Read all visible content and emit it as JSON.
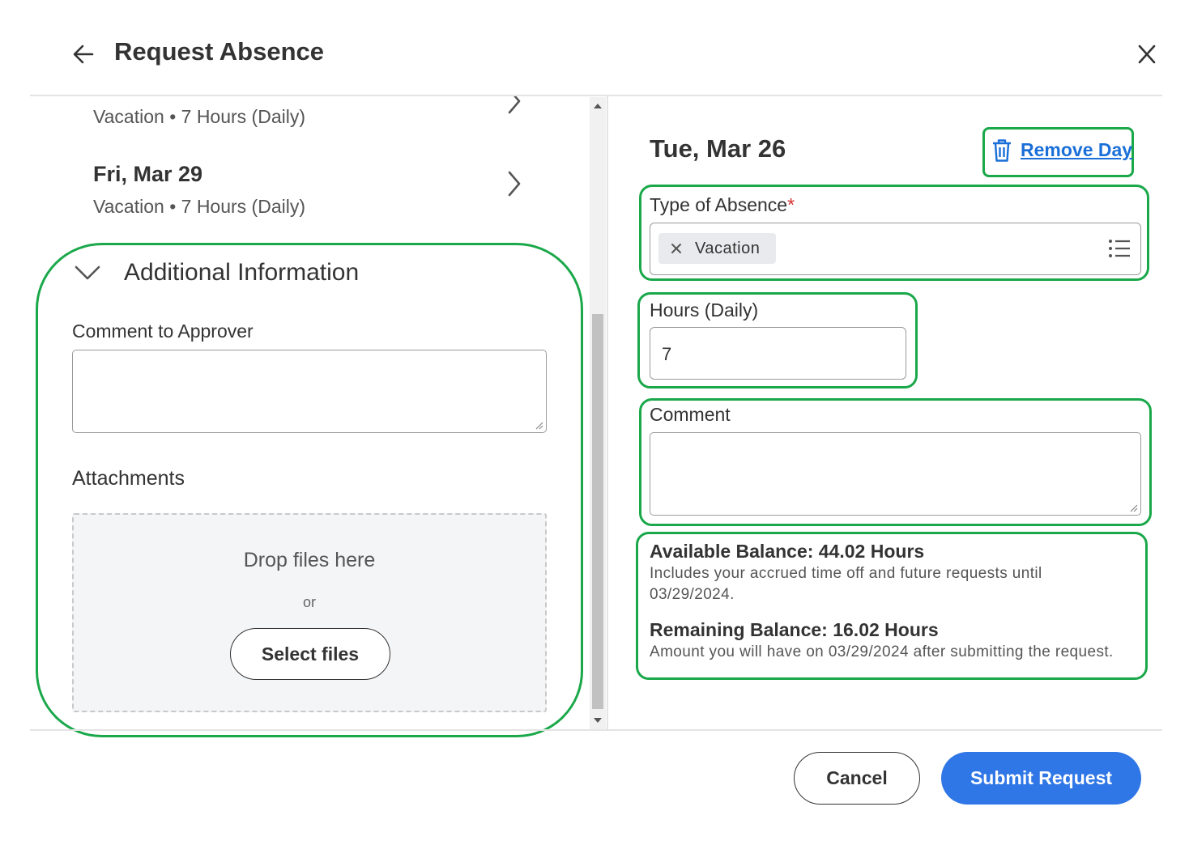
{
  "header": {
    "title": "Request Absence",
    "back_icon": "arrow-left-icon",
    "close_icon": "close-icon"
  },
  "left": {
    "days": [
      {
        "date": "",
        "detail": "Vacation • 7 Hours (Daily)"
      },
      {
        "date": "Fri, Mar 29",
        "detail": "Vacation • 7 Hours (Daily)"
      }
    ],
    "additional_info": {
      "title": "Additional Information",
      "comment_label": "Comment to Approver",
      "comment_value": "",
      "attachments_label": "Attachments",
      "drop_text": "Drop files here",
      "or_text": "or",
      "select_files": "Select files"
    }
  },
  "right": {
    "date": "Tue, Mar 26",
    "remove_day": "Remove Day",
    "type_label": "Type of Absence",
    "required_mark": "*",
    "type_value": "Vacation",
    "hours_label": "Hours (Daily)",
    "hours_value": "7",
    "comment_label": "Comment",
    "comment_value": "",
    "available_balance": "Available Balance: 44.02 Hours",
    "available_note": "Includes your accrued time off and future requests until 03/29/2024.",
    "remaining_balance": "Remaining Balance: 16.02 Hours",
    "remaining_note": "Amount you will have on 03/29/2024 after submitting the request."
  },
  "footer": {
    "cancel": "Cancel",
    "submit": "Submit Request"
  },
  "colors": {
    "accent": "#2f76e6",
    "link": "#1a6fd8",
    "highlight": "#1aa84a",
    "required": "#d43030"
  }
}
